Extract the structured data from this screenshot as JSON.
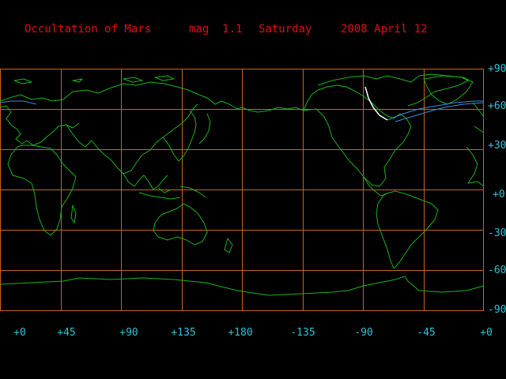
{
  "title": {
    "event": "Occultation of Mars",
    "magnitude": "mag  1.1",
    "weekday": "Saturday",
    "date": "2008 April 12"
  },
  "colors": {
    "background": "#000000",
    "title": "#e01010",
    "grid": "#c8641e",
    "coast": "#18b418",
    "labels": "#2ec4d6",
    "track_white": "#ffffff",
    "track_blue": "#3c8cdc"
  },
  "lat_labels": [
    "+90",
    "+60",
    "+30",
    "+0",
    "-30",
    "-60",
    "-90"
  ],
  "lon_labels": [
    "+0",
    "+45",
    "+90",
    "+135",
    "+180",
    "-135",
    "-90",
    "-45",
    "+0"
  ]
}
